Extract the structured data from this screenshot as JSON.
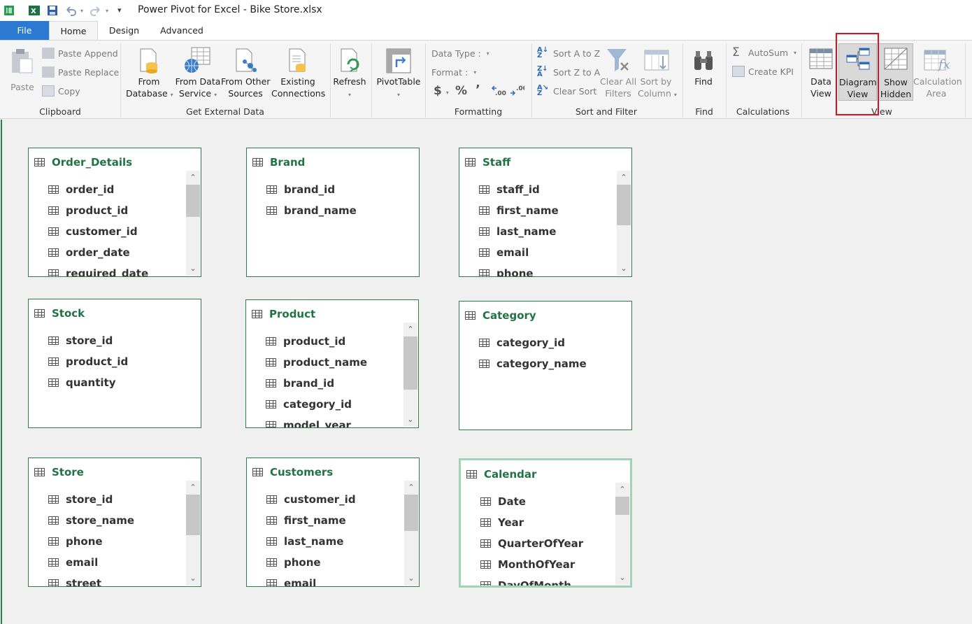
{
  "title": "Power Pivot for Excel - Bike Store.xlsx",
  "tabs": [
    {
      "label": "File"
    },
    {
      "label": "Home"
    },
    {
      "label": "Design"
    },
    {
      "label": "Advanced"
    }
  ],
  "ribbon": {
    "clipboard": {
      "label": "Clipboard",
      "paste": "Paste",
      "paste_append": "Paste Append",
      "paste_replace": "Paste Replace",
      "copy": "Copy"
    },
    "external": {
      "label": "Get External Data",
      "from_database": [
        "From",
        "Database"
      ],
      "from_data_service": [
        "From Data",
        "Service"
      ],
      "from_other_sources": [
        "From Other",
        "Sources"
      ],
      "existing_connections": [
        "Existing",
        "Connections"
      ]
    },
    "refresh": "Refresh",
    "pivottable": "PivotTable",
    "formatting": {
      "label": "Formatting",
      "data_type": "Data Type :",
      "format": "Format :",
      "currency": "$",
      "percent": "%",
      "comma": "ʼ"
    },
    "sort_filter": {
      "label": "Sort and Filter",
      "sort_a_z": "Sort A to Z",
      "sort_z_a": "Sort Z to A",
      "clear_sort": "Clear Sort",
      "clear_all_filters": [
        "Clear All",
        "Filters"
      ],
      "sort_by_column": [
        "Sort by",
        "Column"
      ]
    },
    "find": {
      "label": "Find",
      "button": "Find"
    },
    "calculations": {
      "label": "Calculations",
      "autosum": "AutoSum",
      "create_kpi": "Create KPI"
    },
    "view": {
      "label": "View",
      "data_view": [
        "Data",
        "View"
      ],
      "diagram_view": [
        "Diagram",
        "View"
      ],
      "show_hidden": [
        "Show",
        "Hidden"
      ],
      "calculation_area": [
        "Calculation",
        "Area"
      ]
    }
  },
  "tables": [
    {
      "name": "Order_Details",
      "columns": [
        "order_id",
        "product_id",
        "customer_id",
        "order_date",
        "required_date"
      ],
      "scroll": true
    },
    {
      "name": "Brand",
      "columns": [
        "brand_id",
        "brand_name"
      ],
      "scroll": false
    },
    {
      "name": "Staff",
      "columns": [
        "staff_id",
        "first_name",
        "last_name",
        "email",
        "phone"
      ],
      "scroll": true
    },
    {
      "name": "Stock",
      "columns": [
        "store_id",
        "product_id",
        "quantity"
      ],
      "scroll": false
    },
    {
      "name": "Product",
      "columns": [
        "product_id",
        "product_name",
        "brand_id",
        "category_id",
        "model_year"
      ],
      "scroll": true
    },
    {
      "name": "Category",
      "columns": [
        "category_id",
        "category_name"
      ],
      "scroll": false
    },
    {
      "name": "Store",
      "columns": [
        "store_id",
        "store_name",
        "phone",
        "email",
        "street"
      ],
      "scroll": true
    },
    {
      "name": "Customers",
      "columns": [
        "customer_id",
        "first_name",
        "last_name",
        "phone",
        "email"
      ],
      "scroll": true
    },
    {
      "name": "Calendar",
      "columns": [
        "Date",
        "Year",
        "QuarterOfYear",
        "MonthOfYear",
        "DayOfMonth"
      ],
      "scroll": true
    }
  ]
}
